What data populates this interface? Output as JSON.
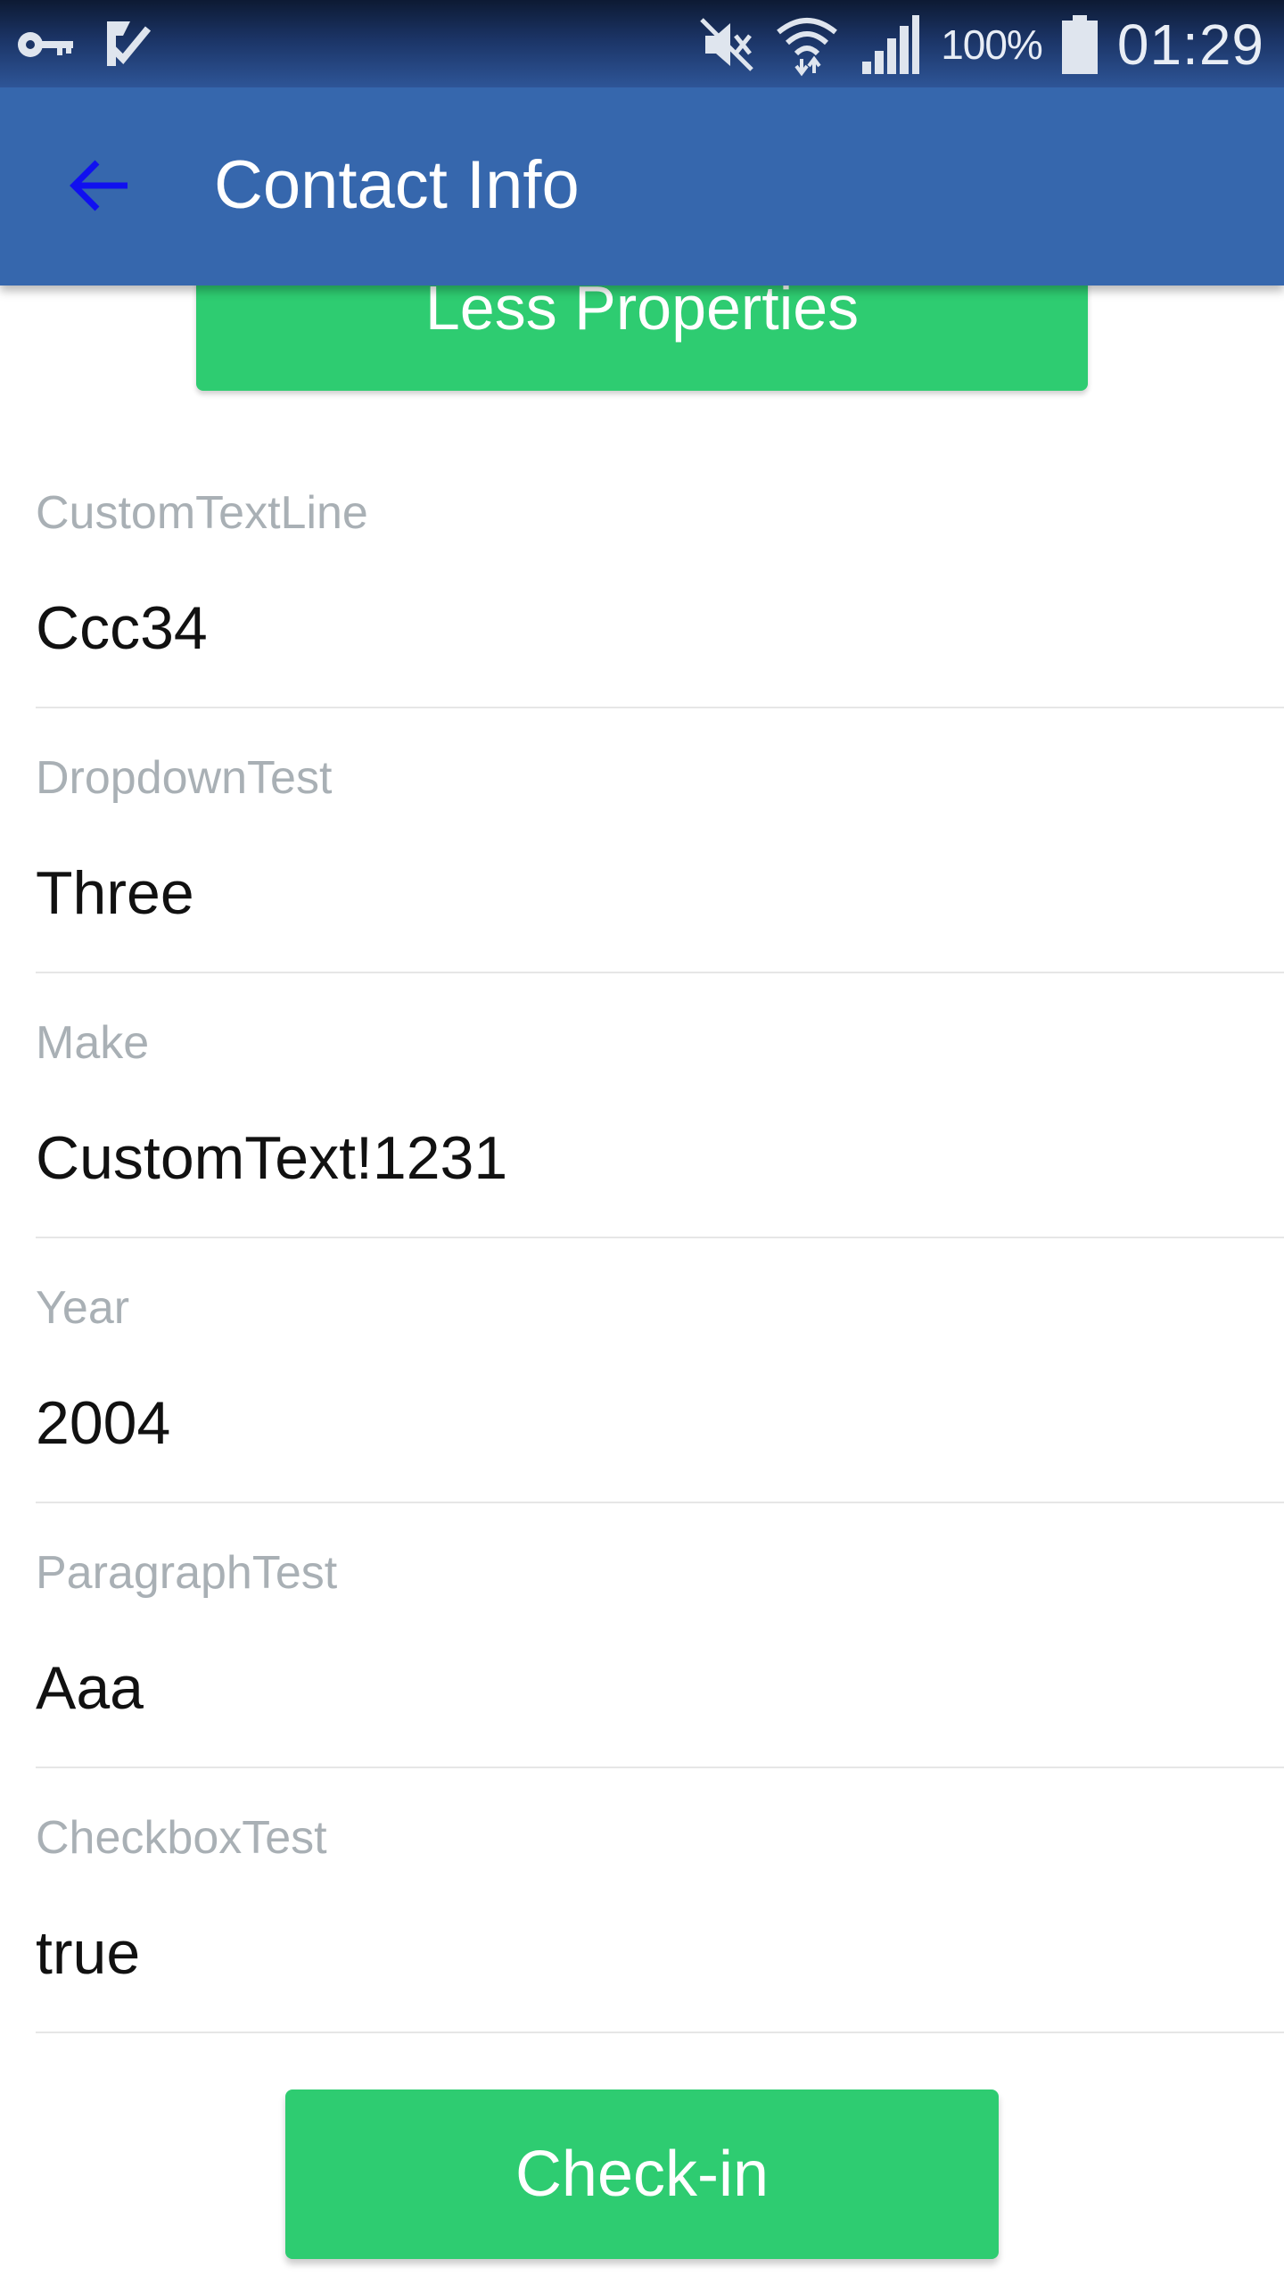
{
  "status_bar": {
    "battery_pct": "100%",
    "time": "01:29",
    "icons": [
      "key-icon",
      "task-check-icon",
      "mute-icon",
      "wifi-icon",
      "signal-icon",
      "battery-icon"
    ]
  },
  "app_bar": {
    "title": "Contact Info",
    "back_icon": "arrow-left-icon",
    "back_icon_color": "#1010f0",
    "background": "#3667ad"
  },
  "less_properties_button": {
    "label": "Less Properties",
    "color": "#2ecc71"
  },
  "fields": [
    {
      "label": "CustomTextLine",
      "value": "Ccc34"
    },
    {
      "label": "DropdownTest",
      "value": "Three"
    },
    {
      "label": "Make",
      "value": "CustomText!1231"
    },
    {
      "label": "Year",
      "value": "2004"
    },
    {
      "label": "ParagraphTest",
      "value": "Aaa"
    },
    {
      "label": "CheckboxTest",
      "value": "true"
    }
  ],
  "checkin_button": {
    "label": "Check-in",
    "color": "#2ecc71"
  }
}
